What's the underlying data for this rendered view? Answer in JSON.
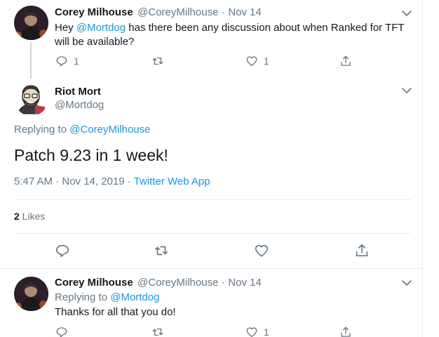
{
  "tweet1": {
    "name": "Corey Milhouse",
    "handle": "@CoreyMilhouse",
    "dot": "·",
    "date": "Nov 14",
    "text_hey": "Hey ",
    "mention": "@Mortdog",
    "text_rest": " has there been any discussion about when Ranked for TFT",
    "text_line2": "will be available?",
    "reply_count": "1",
    "like_count": "1"
  },
  "main_tweet": {
    "name": "Riot Mort",
    "handle": "@Mortdog",
    "replying_prefix": "Replying to ",
    "replying_to": "@CoreyMilhouse",
    "text": "Patch 9.23 in 1 week!",
    "timestamp": "5:47 AM · Nov 14, 2019 · ",
    "source": "Twitter Web App",
    "likes_count": "2",
    "likes_label": " Likes"
  },
  "tweet3": {
    "name": "Corey Milhouse",
    "handle": "@CoreyMilhouse",
    "dot": "·",
    "date": "Nov 14",
    "replying_prefix": "Replying to ",
    "replying_to": "@Mortdog",
    "text": "Thanks for all that you do!",
    "like_count": "1"
  },
  "icons": [
    "reply-icon",
    "retweet-icon",
    "like-icon",
    "share-icon",
    "chevron-down-icon"
  ],
  "colors": {
    "accent": "#1b95e0",
    "muted": "#657786",
    "border": "#e6ecf0"
  }
}
